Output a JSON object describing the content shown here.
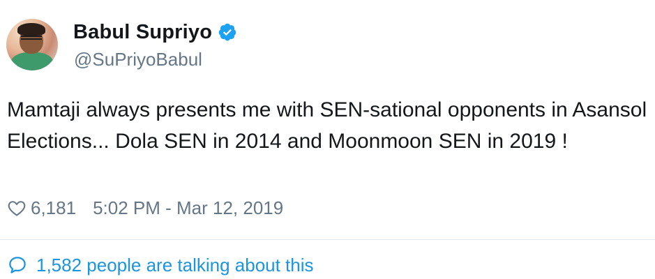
{
  "author": {
    "display_name": "Babul Supriyo",
    "handle": "@SuPriyoBabul",
    "verified": true,
    "verified_color": "#1da1f2"
  },
  "tweet": {
    "text": "Mamtaji always presents me with SEN-sational opponents in Asansol Elections... Dola SEN in 2014 and Moonmoon SEN in 2019 !",
    "like_count": "6,181",
    "timestamp": "5:02 PM - Mar 12, 2019"
  },
  "footer": {
    "talking_text": "1,582 people are talking about this",
    "link_color": "#1b95e0"
  },
  "icons": {
    "verified": "verified-badge-icon",
    "like": "heart-icon",
    "reply": "speech-bubble-icon"
  }
}
